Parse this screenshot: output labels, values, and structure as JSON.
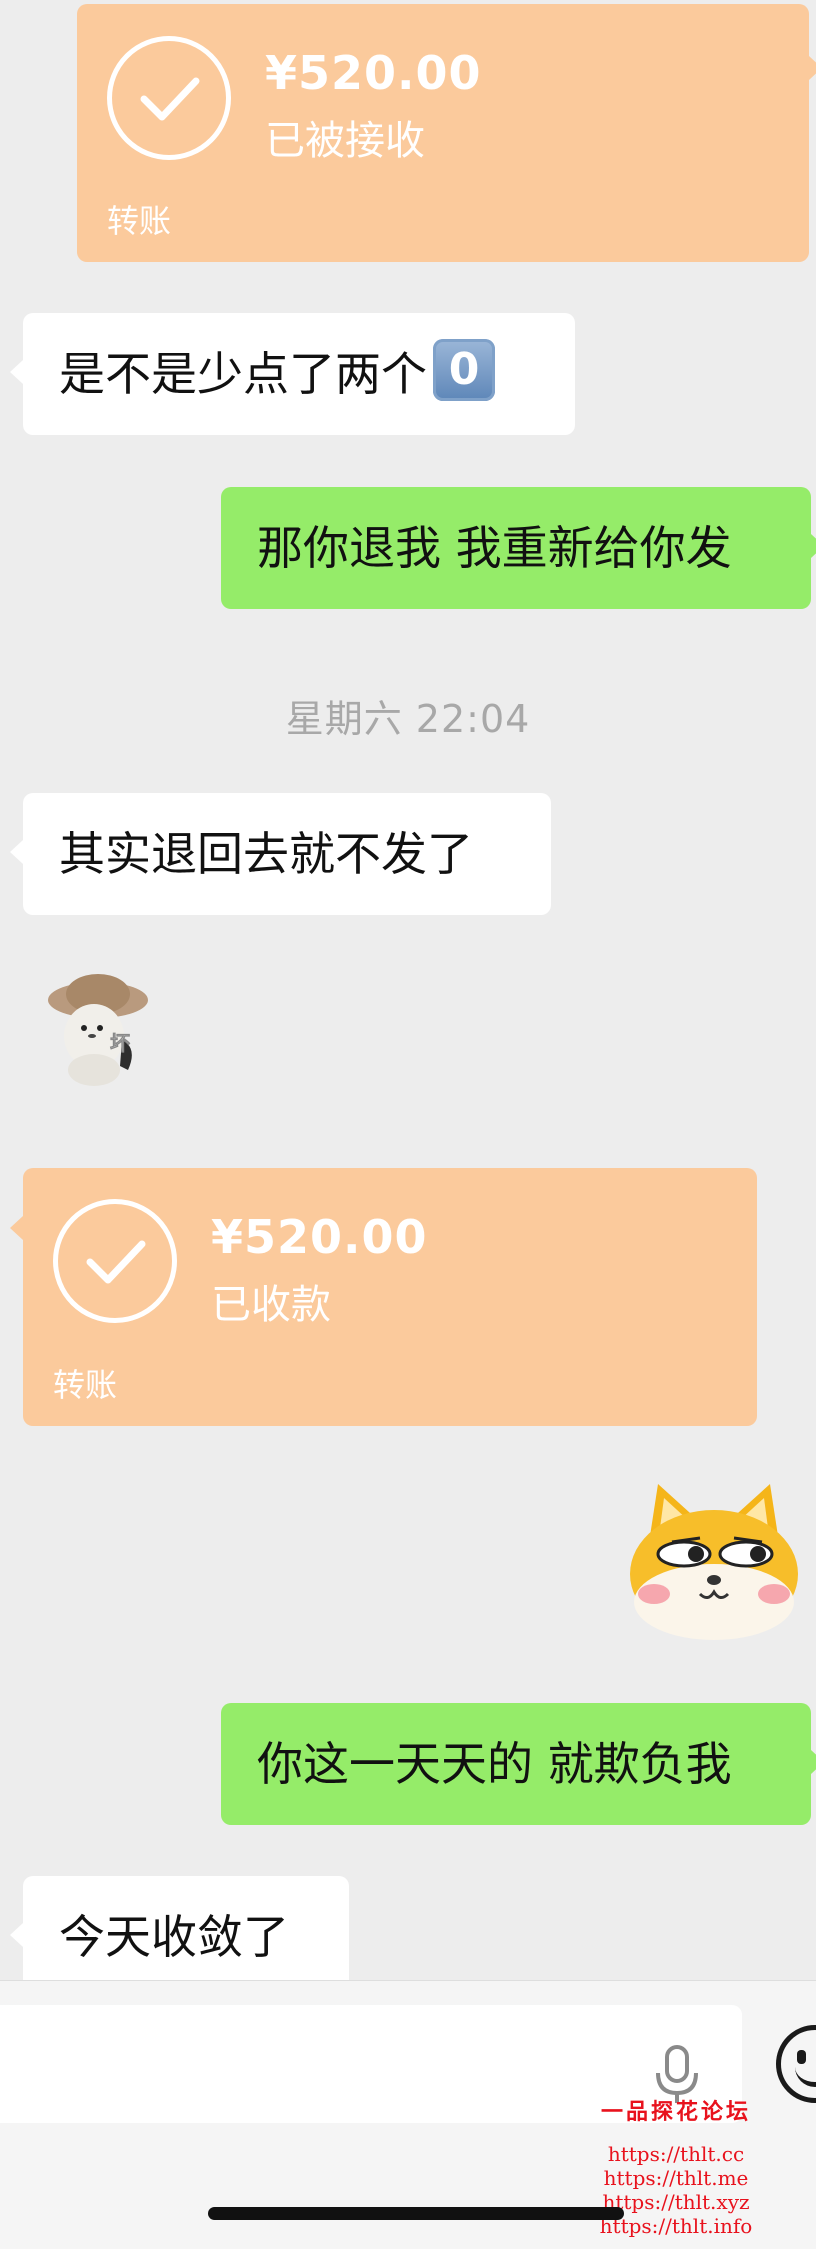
{
  "messages": {
    "transfer_1": {
      "amount": "¥520.00",
      "status": "已被接收",
      "type": "转账"
    },
    "msg_1": {
      "text": "是不是少点了两个",
      "emoji": "0"
    },
    "msg_2": {
      "text": "那你退我 我重新给你发"
    },
    "timestamp": "星期六 22:04",
    "msg_3": {
      "text": "其实退回去就不发了"
    },
    "sticker_1": {
      "icon": "cat-sticker-icon",
      "caption": "坏"
    },
    "transfer_2": {
      "amount": "¥520.00",
      "status": "已收款",
      "type": "转账"
    },
    "sticker_2": {
      "icon": "shiba-smirk-sticker-icon"
    },
    "msg_4": {
      "text": "你这一天天的 就欺负我"
    },
    "msg_5": {
      "text": "今天收敛了"
    }
  },
  "input_bar": {
    "watermark_title": "一品探花论坛",
    "watermark_urls": [
      "https://thlt.cc",
      "https://thlt.me",
      "https://thlt.xyz",
      "https://thlt.info"
    ]
  },
  "colors": {
    "background": "#ededed",
    "transfer_card": "#fbca9c",
    "outgoing_bubble": "#95ec69",
    "incoming_bubble": "#ffffff",
    "watermark": "#e8121d"
  }
}
